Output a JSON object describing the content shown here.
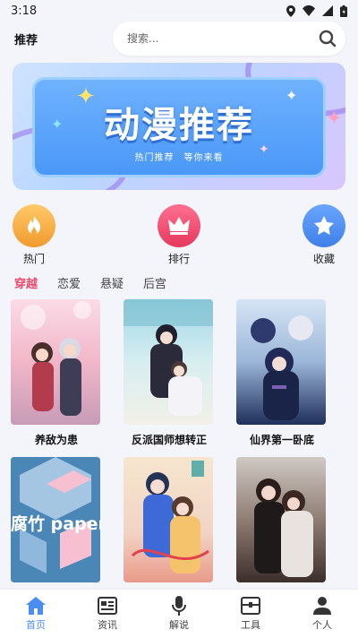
{
  "status_bar": {
    "time": "3:18"
  },
  "header": {
    "title": "推荐",
    "search_placeholder": "搜索..."
  },
  "banner": {
    "title": "动漫推荐",
    "subtitle": "热门推荐　等你来看"
  },
  "categories": [
    {
      "label": "热门",
      "color": "#f5a93a"
    },
    {
      "label": "排行",
      "color": "#ec4a6a"
    },
    {
      "label": "收藏",
      "color": "#4a8ef4"
    }
  ],
  "tabs": [
    {
      "label": "穿越",
      "active": true
    },
    {
      "label": "恋爱",
      "active": false
    },
    {
      "label": "悬疑",
      "active": false
    },
    {
      "label": "后宫",
      "active": false
    }
  ],
  "comics": [
    {
      "title": "养敌为患"
    },
    {
      "title": "反派国师想转正"
    },
    {
      "title": "仙界第一卧底"
    },
    {
      "title": "",
      "cover_text": "腐竹 paper"
    },
    {
      "title": ""
    },
    {
      "title": ""
    }
  ],
  "bottom_nav": [
    {
      "label": "首页",
      "icon": "home-icon",
      "active": true
    },
    {
      "label": "资讯",
      "icon": "news-icon",
      "active": false
    },
    {
      "label": "解说",
      "icon": "mic-icon",
      "active": false
    },
    {
      "label": "工具",
      "icon": "toolbox-icon",
      "active": false
    },
    {
      "label": "个人",
      "icon": "person-icon",
      "active": false
    }
  ],
  "colors": {
    "accent": "#4a8ef4",
    "tab_active": "#ea4c6b"
  }
}
